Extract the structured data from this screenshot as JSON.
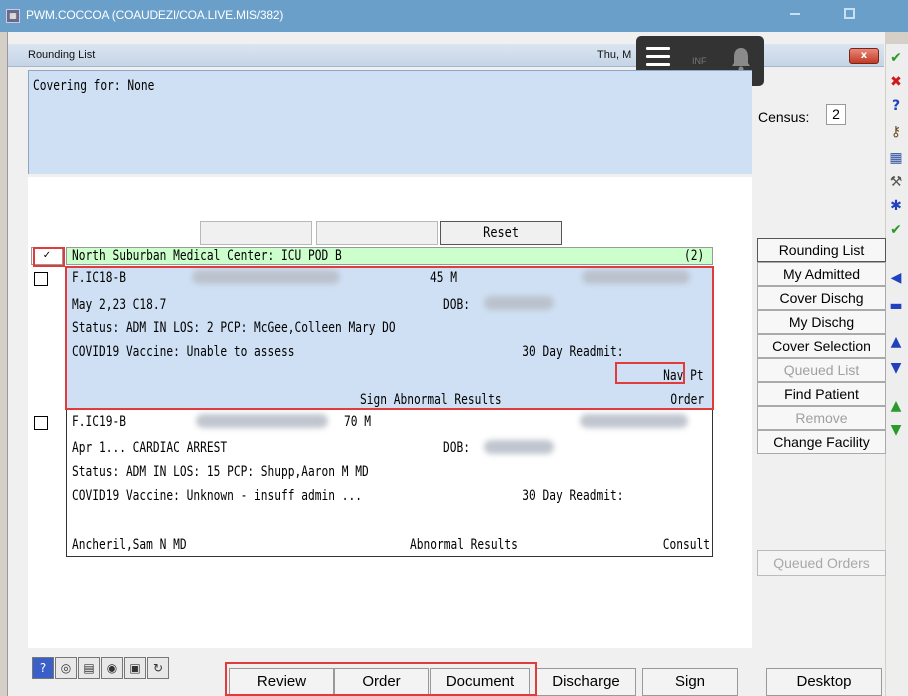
{
  "window": {
    "title": "PWM.COCCOA (COAUDEZI/COA.LIVE.MIS/382)",
    "app_icon": "grid-icon"
  },
  "inner": {
    "title": "Rounding List",
    "date": "Thu, M",
    "close_label": "x"
  },
  "notification_overlay": {
    "text": "INF"
  },
  "covering": {
    "text": "Covering for: None"
  },
  "census": {
    "label": "Census:",
    "value": "2"
  },
  "filters": {
    "reset_label": "Reset"
  },
  "facility": {
    "check": "✓",
    "name": "North Suburban Medical Center:  ICU POD B",
    "count": "(2)",
    "color": "#ccffcc"
  },
  "patients": [
    {
      "room": "F.IC18-B",
      "age_sex": "45 M",
      "admit_line": "May 2,23 C18.7",
      "dob_label": "DOB:",
      "status_line": "Status: ADM IN    LOS: 2    PCP: McGee,Colleen Mary  DO",
      "vaccine_line": "COVID19 Vaccine: Unable to assess",
      "readmit_label": "30 Day Readmit:",
      "nav_label": "Nav Pt",
      "footer_left": "",
      "footer_mid": "Sign Abnormal Results",
      "footer_right": "Order",
      "highlight_color": "#cfe0f4"
    },
    {
      "room": "F.IC19-B",
      "age_sex": "70 M",
      "admit_line": "Apr 1... CARDIAC ARREST",
      "dob_label": "DOB:",
      "status_line": "Status: ADM IN    LOS: 15    PCP: Shupp,Aaron M  MD",
      "vaccine_line": "COVID19 Vaccine: Unknown - insuff admin ...",
      "readmit_label": "30 Day Readmit:",
      "footer_left": "Ancheril,Sam N  MD",
      "footer_mid": "Abnormal Results",
      "footer_right": "Consult"
    }
  ],
  "side_buttons": [
    {
      "label": "Rounding List",
      "enabled": true
    },
    {
      "label": "My Admitted",
      "enabled": true
    },
    {
      "label": "Cover Dischg",
      "enabled": true
    },
    {
      "label": "My Dischg",
      "enabled": true
    },
    {
      "label": "Cover Selection",
      "enabled": true
    },
    {
      "label": "Queued List",
      "enabled": false
    },
    {
      "label": "Find Patient",
      "enabled": true
    },
    {
      "label": "Remove",
      "enabled": false
    },
    {
      "label": "Change Facility",
      "enabled": true
    }
  ],
  "queued_orders": {
    "label": "Queued Orders",
    "enabled": false
  },
  "toolbar_icons": [
    "help-icon",
    "search-icon",
    "list-icon",
    "globe-icon",
    "print-icon",
    "refresh-icon"
  ],
  "bottom_buttons": [
    {
      "label": "Review"
    },
    {
      "label": "Order"
    },
    {
      "label": "Document"
    },
    {
      "label": "Discharge"
    },
    {
      "label": "Sign"
    },
    {
      "label": "Desktop"
    }
  ],
  "right_strip_icons": [
    "check-icon",
    "x-icon",
    "help-icon",
    "key-icon",
    "calendar-icon",
    "tools-icon",
    "wrench-icon",
    "check-icon",
    "arrow-left-icon",
    "minus-icon",
    "arrow-up-icon",
    "arrow-down-icon",
    "arrow-up-green-icon",
    "arrow-down-green-icon"
  ],
  "colors": {
    "titlebar": "#6a9fca",
    "covering_bg": "#cfe0f4",
    "highlight_red": "#e03c3c",
    "close_red": "#c23a26"
  }
}
